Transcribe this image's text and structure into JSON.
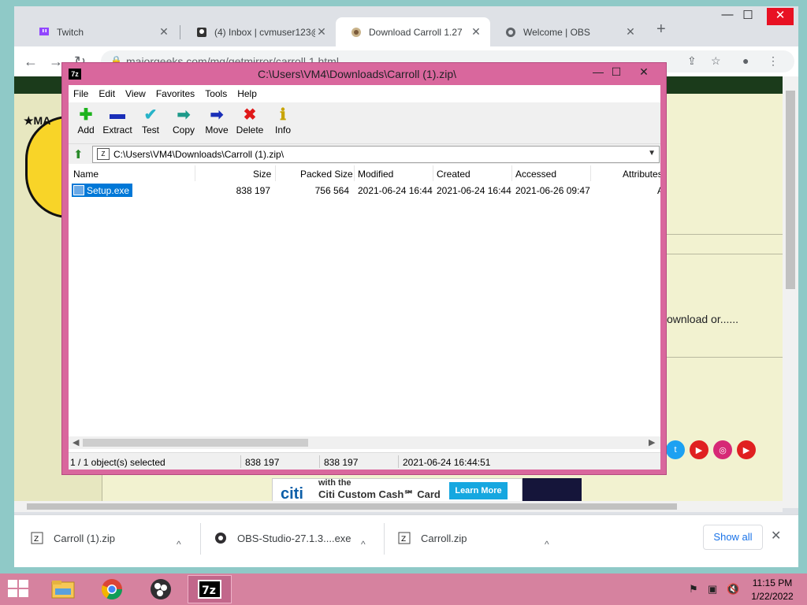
{
  "chrome": {
    "tabs": [
      {
        "title": "Twitch",
        "icon": "twitch-icon"
      },
      {
        "title": "(4) Inbox | cvmuser123@",
        "icon": "mail-icon"
      },
      {
        "title": "Download Carroll 1.27",
        "icon": "majorgeeks-icon"
      },
      {
        "title": "Welcome | OBS",
        "icon": "globe-icon"
      }
    ],
    "url": "majorgeeks.com/mg/getmirror/carroll,1.html",
    "page_text": "ownload or......",
    "logo_badge": "★MA",
    "ad": {
      "line1": "with the",
      "line2": "Citi Custom Cash℠ Card",
      "logo": "citi",
      "button": "Learn More"
    }
  },
  "downloads": {
    "items": [
      {
        "name": "Carroll (1).zip"
      },
      {
        "name": "OBS-Studio-27.1.3....exe"
      },
      {
        "name": "Carroll.zip"
      }
    ],
    "show_all": "Show all"
  },
  "sevenzip": {
    "app_icon": "7z",
    "title": "C:\\Users\\VM4\\Downloads\\Carroll (1).zip\\",
    "menu": [
      "File",
      "Edit",
      "View",
      "Favorites",
      "Tools",
      "Help"
    ],
    "tools": [
      {
        "label": "Add",
        "glyph": "✚",
        "color": "#1db31d"
      },
      {
        "label": "Extract",
        "glyph": "▬",
        "color": "#1a2fb8"
      },
      {
        "label": "Test",
        "glyph": "✔",
        "color": "#27b3c8"
      },
      {
        "label": "Copy",
        "glyph": "➡",
        "color": "#1d9a8a"
      },
      {
        "label": "Move",
        "glyph": "➡",
        "color": "#1a2fb8"
      },
      {
        "label": "Delete",
        "glyph": "✖",
        "color": "#e01919"
      },
      {
        "label": "Info",
        "glyph": "ℹ",
        "color": "#c8a400"
      }
    ],
    "address": "C:\\Users\\VM4\\Downloads\\Carroll (1).zip\\",
    "columns": [
      "Name",
      "Size",
      "Packed Size",
      "Modified",
      "Created",
      "Accessed",
      "Attributes"
    ],
    "rows": [
      {
        "name": "Setup.exe",
        "size": "838 197",
        "packed": "756 564",
        "modified": "2021-06-24 16:44",
        "created": "2021-06-24 16:44",
        "accessed": "2021-06-26 09:47",
        "attributes": "A"
      }
    ],
    "status": {
      "selected": "1 / 1 object(s) selected",
      "size": "838 197",
      "packed": "838 197",
      "date": "2021-06-24 16:44:51"
    }
  },
  "taskbar": {
    "time": "11:15 PM",
    "date": "1/22/2022"
  }
}
